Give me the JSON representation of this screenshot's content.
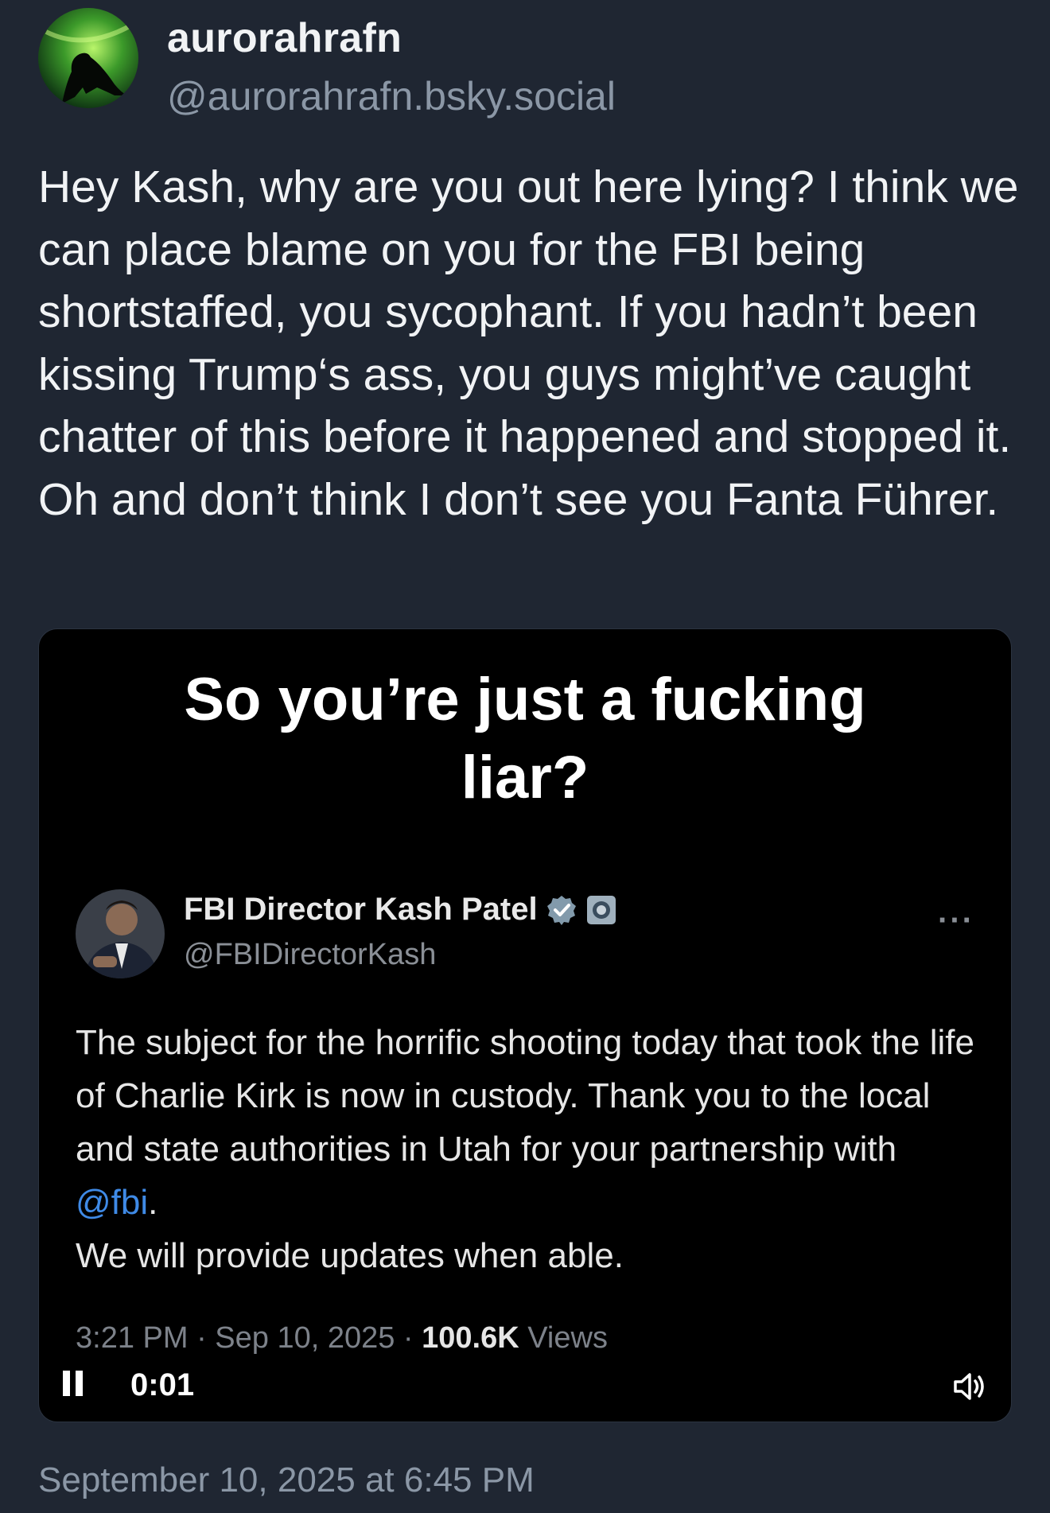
{
  "author": {
    "display_name": "aurorahrafn",
    "handle": "@aurorahrafn.bsky.social"
  },
  "post": {
    "text": "Hey Kash, why are you out here lying? I think we can place blame on you for the FBI being shortstaffed, you sycophant. If you hadn’t been kissing Trump‘s ass, you guys might’ve caught chatter of this before it happened and stopped it. Oh and don’t think I don’t see you Fanta Führer.",
    "timestamp": "September 10, 2025 at 6:45 PM"
  },
  "video": {
    "caption_line1": "So you’re just a fucking",
    "caption_line2": "liar?",
    "elapsed": "0:01",
    "tweet": {
      "name": "FBI Director Kash Patel",
      "handle": "@FBIDirectorKash",
      "more": "···",
      "text_before_mention": "The subject for the horrific shooting today that took the life of Charlie Kirk is now in custody. Thank you to the local and state authorities in Utah for your partnership with ",
      "mention": "@fbi",
      "text_after_mention": ".",
      "second_line": "We will provide updates when able.",
      "time": "3:21 PM · Sep 10, 2025 · ",
      "views_count": "100.6K",
      "views_label": " Views"
    }
  },
  "colors": {
    "background": "#1f2632",
    "muted_text": "#8b97a6",
    "mention": "#3f8ae6"
  }
}
